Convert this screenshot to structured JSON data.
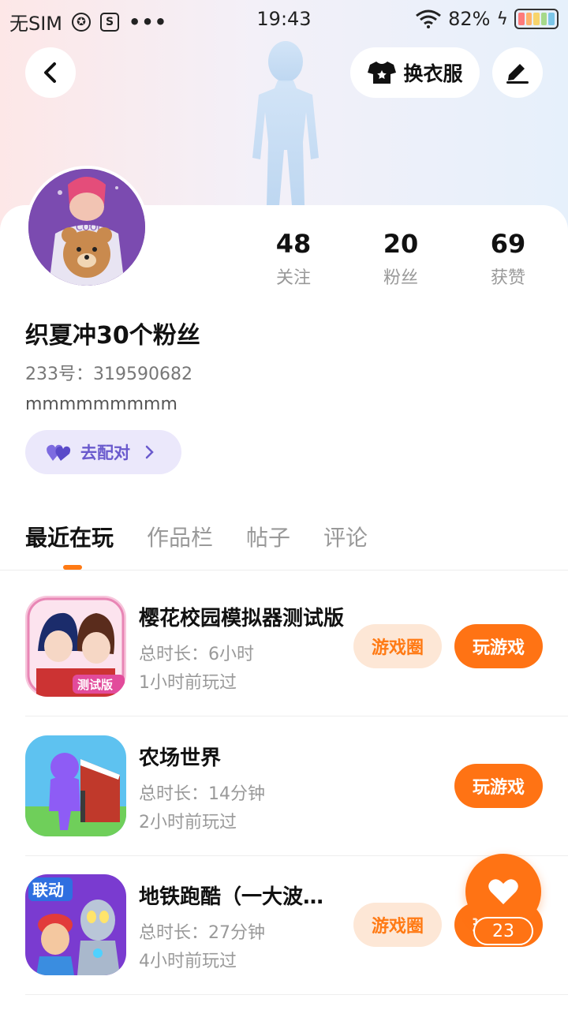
{
  "status_bar": {
    "carrier": "无SIM",
    "time": "19:43",
    "battery": "82%",
    "icons": [
      "compass-icon",
      "s-icon",
      "more-icon",
      "wifi-icon",
      "charging-icon",
      "battery-icon"
    ]
  },
  "header": {
    "outfit_label": "换衣服",
    "icons": [
      "back-icon",
      "shirt-icon",
      "edit-icon"
    ]
  },
  "profile": {
    "stats": [
      {
        "value": "48",
        "label": "关注"
      },
      {
        "value": "20",
        "label": "粉丝"
      },
      {
        "value": "69",
        "label": "获赞"
      }
    ],
    "nickname": "织夏冲30个粉丝",
    "uid": "233号：319590682",
    "bio": "mmmmmmmmm",
    "match_label": "去配对"
  },
  "tabs": [
    "最近在玩",
    "作品栏",
    "帖子",
    "评论"
  ],
  "games": [
    {
      "title": "樱花校园模拟器测试版",
      "duration": "总时长：6小时",
      "last_played": "1小时前玩过",
      "circle_label": "游戏圈",
      "play_label": "玩游戏"
    },
    {
      "title": "农场世界",
      "duration": "总时长：14分钟",
      "last_played": "2小时前玩过",
      "play_label": "玩游戏"
    },
    {
      "title": "地铁跑酷（一大波新版本）",
      "duration": "总时长：27分钟",
      "last_played": "4小时前玩过",
      "circle_label": "游戏圈",
      "play_label": "玩游戏"
    }
  ],
  "like_count": "23",
  "colors": {
    "accent": "#ff7314",
    "accent_light": "#fde7d6",
    "match_bg": "#ebe8fb",
    "match_text": "#6a5acd"
  }
}
